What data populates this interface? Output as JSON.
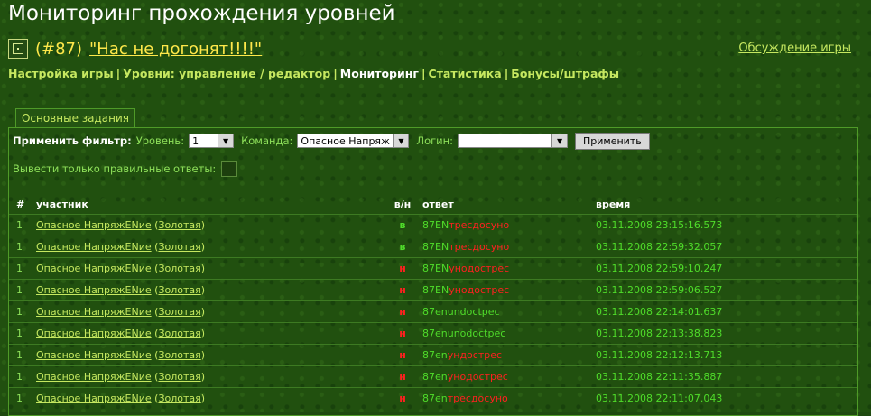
{
  "page_title": "Мониторинг прохождения уровней",
  "game": {
    "number": "(#87)",
    "name": "\"Нас не догонят!!!!\"",
    "discussion_link": "Обсуждение игры"
  },
  "nav": {
    "settings": "Настройка игры",
    "levels_label": "Уровни:",
    "manage": "управление",
    "slash": "/",
    "editor": "редактор",
    "monitoring": "Мониторинг",
    "statistics": "Статистика",
    "bonuses": "Бонусы/штрафы",
    "sep": "|"
  },
  "tab": {
    "label": "Основные задания"
  },
  "filter": {
    "label": "Применить фильтр:",
    "level_label": "Уровень:",
    "level_value": "1",
    "team_label": "Команда:",
    "team_value": "Опасное Напряж",
    "login_label": "Логин:",
    "login_value": "",
    "apply_button": "Применить",
    "only_correct_label": "Вывести только правильные ответы:"
  },
  "table": {
    "headers": {
      "num": "#",
      "participant": "участник",
      "vn": "в/н",
      "answer": "ответ",
      "time": "время"
    },
    "rows": [
      {
        "num": "1",
        "team": "Опасное НапряжЕNие",
        "group": "Золотая",
        "vn": "в",
        "ans_ok": "87EN",
        "ans_bad": "тресдосуно",
        "time": "03.11.2008 23:15:16.573"
      },
      {
        "num": "1",
        "team": "Опасное НапряжЕNие",
        "group": "Золотая",
        "vn": "в",
        "ans_ok": "87EN",
        "ans_bad": "тресдосуно",
        "time": "03.11.2008 22:59:32.057"
      },
      {
        "num": "1",
        "team": "Опасное НапряжЕNие",
        "group": "Золотая",
        "vn": "н",
        "ans_ok": "87EN",
        "ans_bad": "унодострес",
        "time": "03.11.2008 22:59:10.247"
      },
      {
        "num": "1",
        "team": "Опасное НапряжЕNие",
        "group": "Золотая",
        "vn": "н",
        "ans_ok": "87EN",
        "ans_bad": "унодострес",
        "time": "03.11.2008 22:59:06.527"
      },
      {
        "num": "1",
        "team": "Опасное НапряжЕNие",
        "group": "Золотая",
        "vn": "н",
        "ans_ok": "87enundoctpec",
        "ans_bad": "",
        "time": "03.11.2008 22:14:01.637"
      },
      {
        "num": "1",
        "team": "Опасное НапряжЕNие",
        "group": "Золотая",
        "vn": "н",
        "ans_ok": "87enunodoctpec",
        "ans_bad": "",
        "time": "03.11.2008 22:13:38.823"
      },
      {
        "num": "1",
        "team": "Опасное НапряжЕNие",
        "group": "Золотая",
        "vn": "н",
        "ans_ok": "87en",
        "ans_bad": "ундострес",
        "time": "03.11.2008 22:12:13.713"
      },
      {
        "num": "1",
        "team": "Опасное НапряжЕNие",
        "group": "Золотая",
        "vn": "н",
        "ans_ok": "87en",
        "ans_bad": "унодострес",
        "time": "03.11.2008 22:11:35.887"
      },
      {
        "num": "1",
        "team": "Опасное НапряжЕNие",
        "group": "Золотая",
        "vn": "н",
        "ans_ok": "87en",
        "ans_bad": "тресдосуно",
        "time": "03.11.2008 22:11:07.043"
      }
    ]
  }
}
